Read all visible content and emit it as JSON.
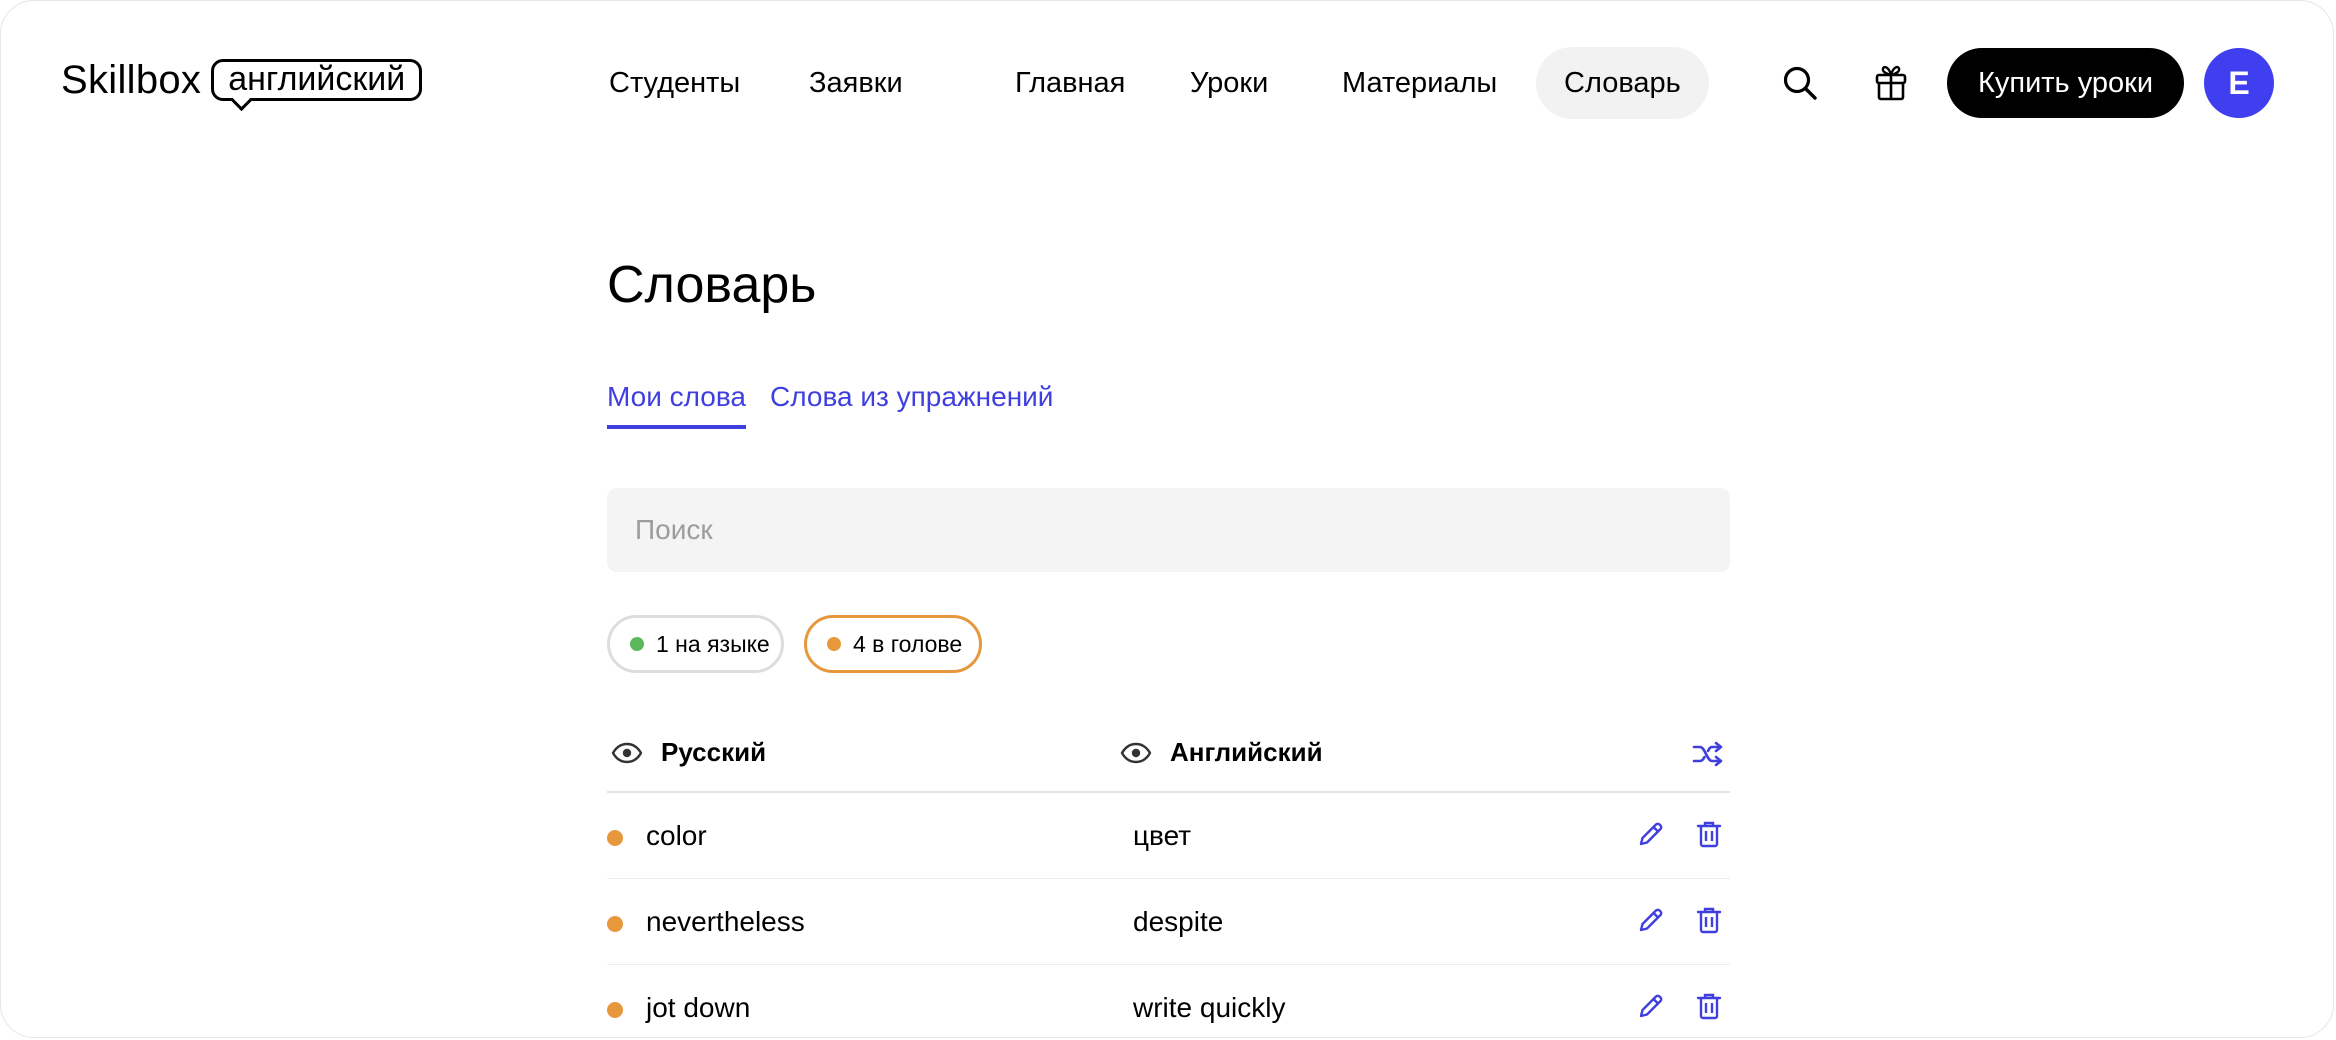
{
  "header": {
    "logo_word": "Skillbox",
    "logo_bubble": "английский",
    "nav": [
      {
        "label": "Студенты"
      },
      {
        "label": "Заявки"
      },
      {
        "label": "Главная"
      },
      {
        "label": "Уроки"
      },
      {
        "label": "Материалы"
      },
      {
        "label": "Словарь",
        "active": true
      }
    ],
    "buy_label": "Купить уроки",
    "avatar_letter": "E",
    "icons": [
      "search-icon",
      "gift-icon"
    ]
  },
  "main": {
    "title": "Словарь",
    "tabs": [
      {
        "label": "Мои слова",
        "active": true
      },
      {
        "label": "Слова из упражнений"
      }
    ],
    "search_placeholder": "Поиск",
    "filters": [
      {
        "label": "1 на языке",
        "dot_color": "#5cb85c",
        "border_color": "#dddddd",
        "selected": false
      },
      {
        "label": "4 в голове",
        "dot_color": "#e8983c",
        "border_color": "#e8983c",
        "selected": true
      }
    ],
    "table": {
      "col_russian": "Русский",
      "col_english": "Английский",
      "shuffle_icon": "shuffle-icon",
      "rows": [
        {
          "word": "color",
          "translation": "цвет",
          "status_color": "#e8983c"
        },
        {
          "word": "nevertheless",
          "translation": "despite",
          "status_color": "#e8983c"
        },
        {
          "word": "jot down",
          "translation": "write quickly",
          "status_color": "#e8983c"
        }
      ]
    }
  },
  "colors": {
    "accent": "#3f3fe0",
    "avatar": "#3f3ff0",
    "buy_button": "#000000",
    "nav_active_bg": "#f2f2f2",
    "search_bg": "#f4f4f4"
  }
}
